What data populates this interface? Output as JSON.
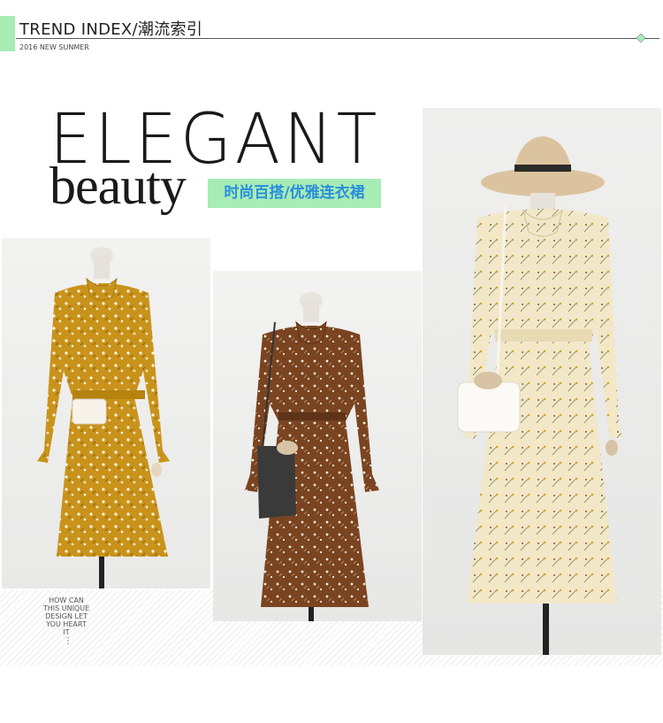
{
  "header": {
    "title": "TREND INDEX/潮流索引",
    "subtitle": "2016 NEW SUNMER",
    "accent_color": "#a8ecb5"
  },
  "headline": {
    "line1": "ELEGANT",
    "line2": "beauty",
    "tagline": "时尚百搭/优雅连衣裙",
    "tagline_color": "#2a8fdc"
  },
  "products": [
    {
      "dress_color": "#c8931a",
      "accessory": "white clutch"
    },
    {
      "dress_color": "#7a4420",
      "accessory": "black shoulder bag"
    },
    {
      "dress_color": "#f1e6c3",
      "accessory": "white handbag and straw hat"
    }
  ],
  "caption": {
    "text": "HOW CAN\nTHIS UNIQUE\nDESIGN LET\nYOU HEART\nIT",
    "dots": "⋮"
  }
}
